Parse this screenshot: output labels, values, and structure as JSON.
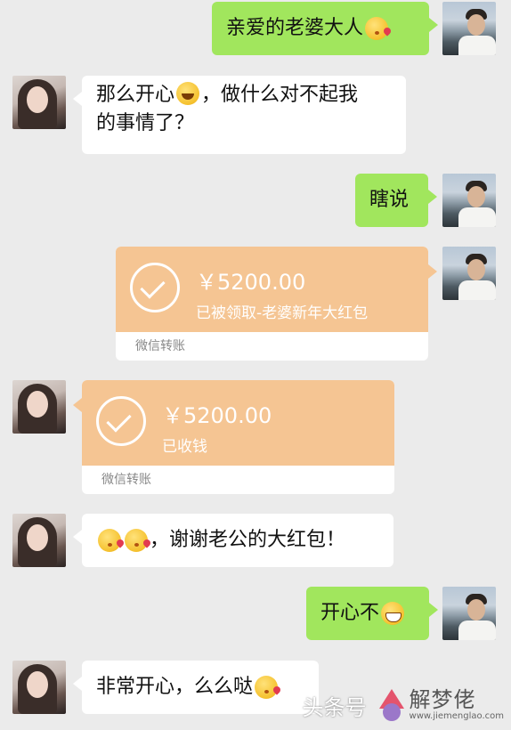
{
  "messages": {
    "m1": {
      "text": "亲爱的老婆大人",
      "emoji": "kiss-emoji"
    },
    "m2": {
      "text_a": "那么开心",
      "emoji": "smile-emoji",
      "text_b": "，做什么对不起我",
      "text_c": "的事情了？"
    },
    "m3": {
      "text": "瞎说"
    },
    "m4": {
      "amount": "￥5200.00",
      "note": "已被领取-老婆新年大红包",
      "label": "微信转账"
    },
    "m5": {
      "amount": "￥5200.00",
      "note": "已收钱",
      "label": "微信转账"
    },
    "m6": {
      "emoji": "kiss-emoji",
      "text": "，谢谢老公的大红包！"
    },
    "m7": {
      "text": "开心不",
      "emoji": "grin-emoji"
    },
    "m8": {
      "text": "非常开心，么么哒",
      "emoji": "kiss-emoji"
    }
  },
  "watermark": {
    "left_text": "头条号",
    "brand": "解梦佬",
    "url": "www.jiemenglao.com"
  },
  "colors": {
    "background": "#ebebeb",
    "sent_bubble": "#a1e65d",
    "received_bubble": "#ffffff",
    "transfer_orange": "#f5c593"
  }
}
